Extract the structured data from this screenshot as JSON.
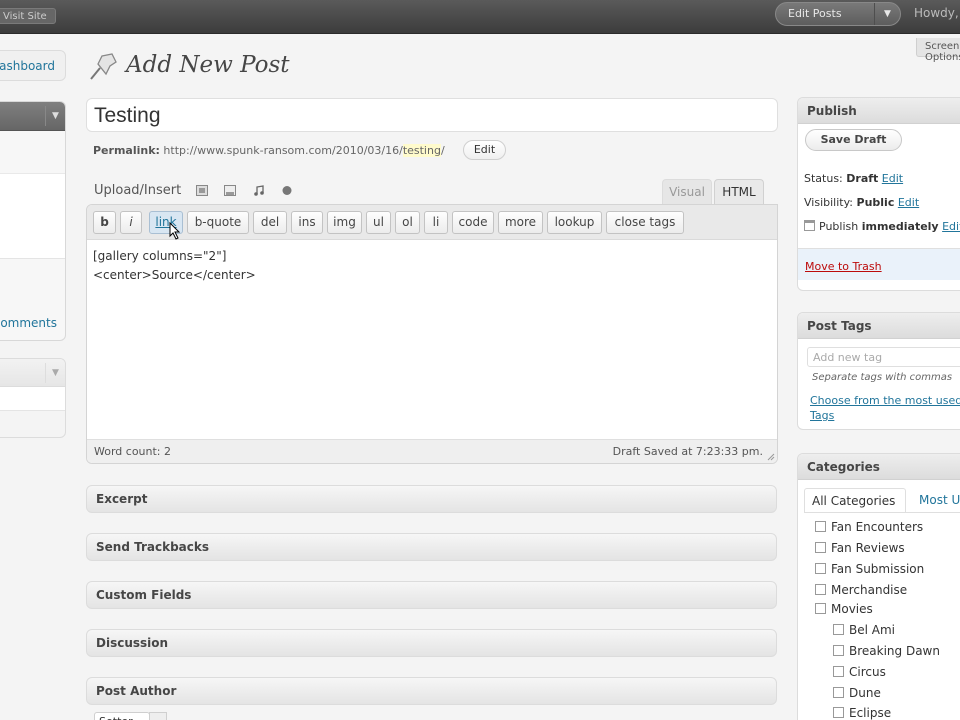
{
  "adminbar": {
    "visit_site": "Visit Site",
    "favorites": "Edit Posts",
    "howdy": "Howdy,"
  },
  "screen_options": "Screen Options",
  "menu": {
    "dashboard": "Dashboard",
    "comments": "Comments"
  },
  "page_title": "Add New Post",
  "post": {
    "title": "Testing",
    "permalink_label": "Permalink:",
    "permalink_base": "http://www.spunk-ransom.com/2010/03/16/",
    "permalink_slug": "testing",
    "permalink_trail": "/",
    "edit_label": "Edit"
  },
  "editor": {
    "upload_label": "Upload/Insert",
    "tab_visual": "Visual",
    "tab_html": "HTML",
    "quicktags": [
      "b",
      "i",
      "link",
      "b-quote",
      "del",
      "ins",
      "img",
      "ul",
      "ol",
      "li",
      "code",
      "more",
      "lookup",
      "close tags"
    ],
    "content_line1": "[gallery columns=\"2\"]",
    "content_line2": "<center>Source</center>",
    "word_count": "Word count: 2",
    "draft_saved": "Draft Saved at 7:23:33 pm."
  },
  "postboxes": [
    "Excerpt",
    "Send Trackbacks",
    "Custom Fields",
    "Discussion",
    "Post Author"
  ],
  "author_value": "Setter",
  "publish": {
    "title": "Publish",
    "save_draft": "Save Draft",
    "status_label": "Status:",
    "status_value": "Draft",
    "visibility_label": "Visibility:",
    "visibility_value": "Public",
    "edit": "Edit",
    "publish_label": "Publish",
    "publish_value": "immediately",
    "move_to_trash": "Move to Trash"
  },
  "tags": {
    "title": "Post Tags",
    "placeholder": "Add new tag",
    "hint": "Separate tags with commas",
    "choose_line1": "Choose from the most used",
    "choose_line2": "Tags"
  },
  "categories": {
    "title": "Categories",
    "tab_all": "All Categories",
    "tab_most": "Most Used",
    "items": [
      {
        "name": "Fan Encounters",
        "level": 0
      },
      {
        "name": "Fan Reviews",
        "level": 0
      },
      {
        "name": "Fan Submission",
        "level": 0
      },
      {
        "name": "Merchandise",
        "level": 0
      },
      {
        "name": "Movies",
        "level": 0
      },
      {
        "name": "Bel Ami",
        "level": 1
      },
      {
        "name": "Breaking Dawn",
        "level": 1
      },
      {
        "name": "Circus",
        "level": 1
      },
      {
        "name": "Dune",
        "level": 1
      },
      {
        "name": "Eclipse",
        "level": 1
      }
    ]
  },
  "colors": {
    "link": "#21759b",
    "trash": "#bc0b0b",
    "adminbar": "#464646"
  }
}
